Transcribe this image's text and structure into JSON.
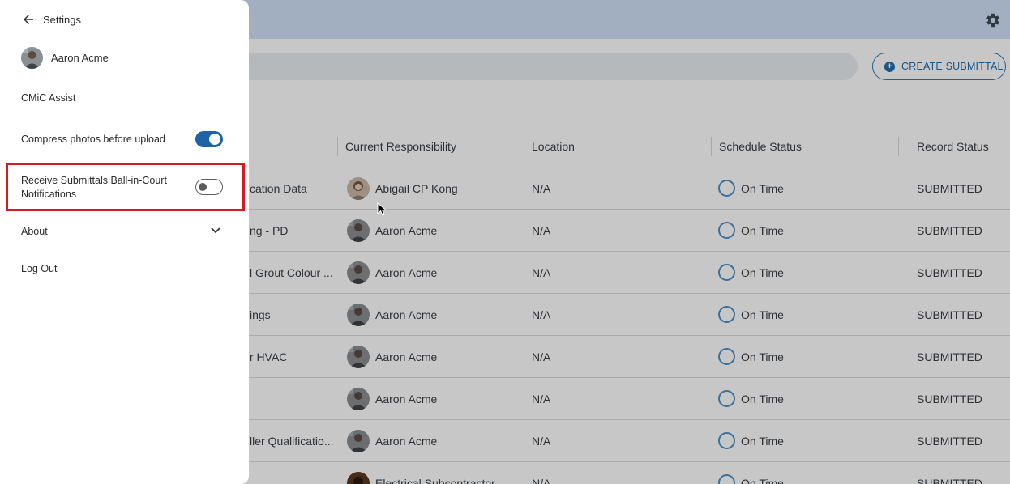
{
  "background": {
    "create_button_label": "CREATE SUBMITTAL",
    "columns": [
      "Current Responsibility",
      "Location",
      "Schedule Status",
      "Record Status"
    ],
    "rows": [
      {
        "name": "cation Data",
        "responsibility": "Abigail CP Kong",
        "location": "N/A",
        "schedule": "On Time",
        "record": "SUBMITTED"
      },
      {
        "name": "ng - PD",
        "responsibility": "Aaron Acme",
        "location": "N/A",
        "schedule": "On Time",
        "record": "SUBMITTED"
      },
      {
        "name": "l Grout Colour ...",
        "responsibility": "Aaron Acme",
        "location": "N/A",
        "schedule": "On Time",
        "record": "SUBMITTED"
      },
      {
        "name": "ings",
        "responsibility": "Aaron Acme",
        "location": "N/A",
        "schedule": "On Time",
        "record": "SUBMITTED"
      },
      {
        "name": "r HVAC",
        "responsibility": "Aaron Acme",
        "location": "N/A",
        "schedule": "On Time",
        "record": "SUBMITTED"
      },
      {
        "name": "",
        "responsibility": "Aaron Acme",
        "location": "N/A",
        "schedule": "On Time",
        "record": "SUBMITTED"
      },
      {
        "name": "ller Qualificatio...",
        "responsibility": "Aaron Acme",
        "location": "N/A",
        "schedule": "On Time",
        "record": "SUBMITTED"
      },
      {
        "name": "",
        "responsibility": "Electrical Subcontractor",
        "location": "N/A",
        "schedule": "On Time",
        "record": "SUBMITTED"
      }
    ]
  },
  "drawer": {
    "title": "Settings",
    "user_name": "Aaron Acme",
    "cmic_assist": "CMiC Assist",
    "compress_label": "Compress photos before upload",
    "compress_on": true,
    "notif_label_line1": "Receive Submittals Ball-in-Court",
    "notif_label_line2": "Notifications",
    "notif_on": false,
    "about": "About",
    "logout": "Log Out"
  },
  "colors": {
    "accent": "#1e62a8",
    "highlight": "#d71920",
    "topbar": "#cfe0f6"
  }
}
